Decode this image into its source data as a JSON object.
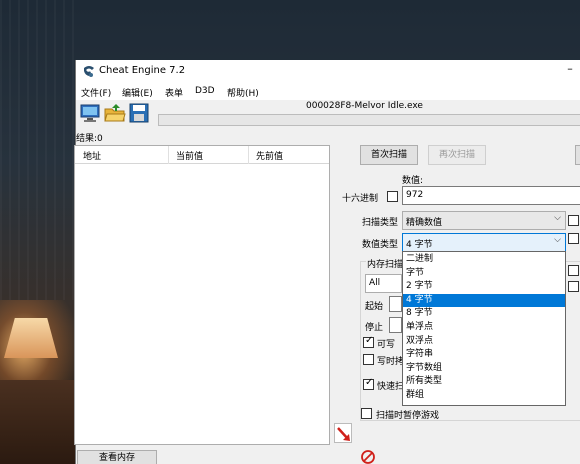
{
  "window": {
    "title": "Cheat Engine 7.2",
    "minimize_glyph": "–"
  },
  "menu": [
    "文件(F)",
    "编辑(E)",
    "表单",
    "D3D",
    "帮助(H)"
  ],
  "toolbar": {
    "icons": [
      "computer-icon",
      "open-folder-icon",
      "save-icon"
    ],
    "process_name": "000028F8-Melvor Idle.exe"
  },
  "results": {
    "label": "结果:0",
    "columns": [
      "地址",
      "当前值",
      "先前值"
    ]
  },
  "scan": {
    "first_scan": "首次扫描",
    "next_scan": "再次扫描",
    "value_label": "数值:",
    "hex_label": "十六进制",
    "value": "972",
    "scan_type_label": "扫描类型",
    "scan_type_value": "精确数值",
    "value_type_label": "数值类型",
    "value_type_value": "4 字节",
    "memory_options_label": "内存扫描",
    "region_value": "All",
    "start_label": "起始",
    "stop_label": "停止",
    "writable_label": "可写",
    "copy_on_write_label": "写时拷",
    "fast_scan_label": "快速扫",
    "pause_game_label": "扫描时暂停游戏"
  },
  "value_type_options": [
    "二进制",
    "字节",
    "2 字节",
    "4 字节",
    "8 字节",
    "单浮点",
    "双浮点",
    "字符串",
    "字节数组",
    "所有类型",
    "群组"
  ],
  "selected_option_index": 3,
  "bottom": {
    "view_memory": "查看内存"
  },
  "colors": {
    "selection": "#0078d7",
    "window_bg": "#f0f0f0",
    "arrow_red": "#d0201a"
  }
}
